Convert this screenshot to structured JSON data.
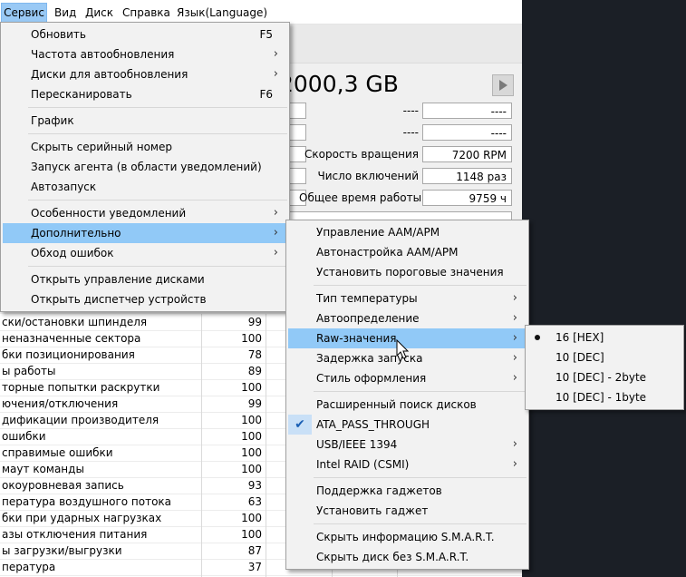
{
  "menubar": [
    "Сервис",
    "Вид",
    "Диск",
    "Справка",
    "Язык(Language)"
  ],
  "capacity": "2000,3 GB",
  "info": {
    "dash1": "----",
    "dash2": "----",
    "dash3": "----",
    "dash4": "----",
    "rotation_label": "Скорость вращения",
    "rotation_value": "7200 RPM",
    "power_count_label": "Число включений",
    "power_count_value": "1148 раз",
    "power_hours_label": "Общее время работы",
    "power_hours_value": "9759 ч"
  },
  "table_rows": [
    {
      "name": "ски/остановки шпинделя",
      "value": "99"
    },
    {
      "name": "неназначенные сектора",
      "value": "100"
    },
    {
      "name": "бки позиционирования",
      "value": "78"
    },
    {
      "name": "ы работы",
      "value": "89"
    },
    {
      "name": "торные попытки раскрутки",
      "value": "100"
    },
    {
      "name": "ючения/отключения",
      "value": "99"
    },
    {
      "name": "дификации производителя",
      "value": "100"
    },
    {
      "name": "ошибки",
      "value": "100"
    },
    {
      "name": "справимые ошибки",
      "value": "100"
    },
    {
      "name": "маут команды",
      "value": "100"
    },
    {
      "name": "окоуровневая запись",
      "value": "93"
    },
    {
      "name": "пература воздушного потока",
      "value": "63"
    },
    {
      "name": "бки при ударных нагрузках",
      "value": "100"
    },
    {
      "name": "азы отключения питания",
      "value": "100"
    },
    {
      "name": "ы загрузки/выгрузки",
      "value": "87"
    },
    {
      "name": "пература",
      "value": "37"
    }
  ],
  "menu1": {
    "obnovit": "Обновить",
    "obnovit_sc": "F5",
    "chastota": "Частота автообновления",
    "diski": "Диски для автообновления",
    "rescan": "Пересканировать",
    "rescan_sc": "F6",
    "graph": "График",
    "hide_serial": "Скрыть серийный номер",
    "agent": "Запуск агента (в области уведомлений)",
    "autostart": "Автозапуск",
    "notify": "Особенности уведомлений",
    "extra": "Дополнительно",
    "errors": "Обход ошибок",
    "disk_mgmt": "Открыть управление дисками",
    "dev_mgr": "Открыть диспетчер устройств"
  },
  "menu2": {
    "aam": "Управление AAM/APM",
    "aam_auto": "Автонастройка AAM/APM",
    "thresholds": "Установить пороговые значения",
    "temp_type": "Тип температуры",
    "autodetect": "Автоопределение",
    "raw": "Raw-значения",
    "delay": "Задержка запуска",
    "style": "Стиль оформления",
    "ext_search": "Расширенный поиск дисков",
    "ata": "ATA_PASS_THROUGH",
    "usb": "USB/IEEE 1394",
    "intel": "Intel RAID (CSMI)",
    "gadget_support": "Поддержка гаджетов",
    "gadget_install": "Установить гаджет",
    "hide_smart": "Скрыть информацию S.M.A.R.T.",
    "hide_no_smart": "Скрыть диск без S.M.A.R.T."
  },
  "menu3": {
    "hex16": "16 [HEX]",
    "dec10": "10 [DEC]",
    "dec10_2": "10 [DEC] - 2byte",
    "dec10_1": "10 [DEC] - 1byte"
  }
}
